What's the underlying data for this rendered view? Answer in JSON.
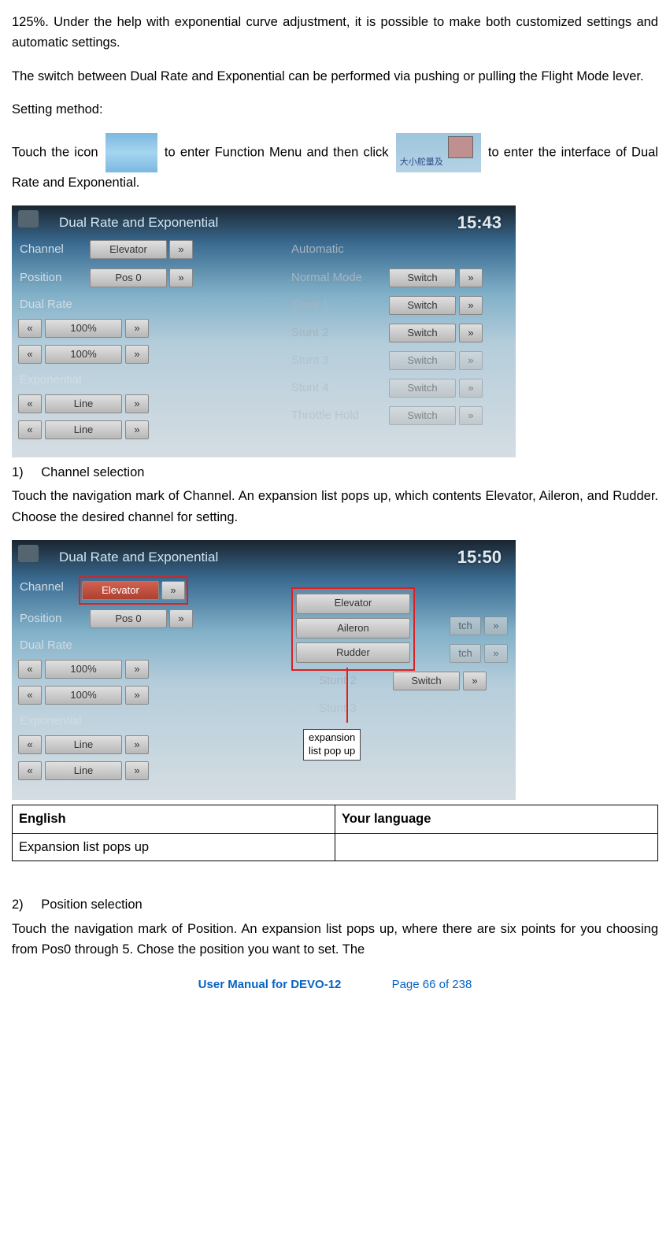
{
  "para1": "125%. Under the help with exponential curve adjustment, it is possible to make both customized settings and automatic settings.",
  "para2": "The switch between Dual Rate and Exponential can be performed via pushing or pulling the Flight Mode lever.",
  "para3": "Setting method:",
  "touch_pre": "Touch the icon ",
  "touch_mid": " to enter Function Menu and then click ",
  "touch_post": " to enter the interface of Dual Rate and Exponential.",
  "ss1": {
    "title": "Dual Rate and Exponential",
    "time": "15:43",
    "channel_lbl": "Channel",
    "channel_val": "Elevator",
    "position_lbl": "Position",
    "position_val": "Pos 0",
    "dualrate_lbl": "Dual Rate",
    "dr1": "100%",
    "dr2": "100%",
    "exp_lbl": "Exponential",
    "exp1": "Line",
    "exp2": "Line",
    "auto": "Automatic",
    "modes": [
      "Normal Mode",
      "Stunt 1",
      "Stunt 2",
      "Stunt 3",
      "Stunt 4",
      "Throttle Hold"
    ],
    "switch": "Switch"
  },
  "heading1_num": "1)",
  "heading1_txt": "Channel selection",
  "para_h1": "Touch the navigation mark of Channel. An expansion list pops up, which contents Elevator, Aileron, and Rudder. Choose the desired channel for setting.",
  "ss2": {
    "title": "Dual Rate and Exponential",
    "time": "15:50",
    "popup": [
      "Elevator",
      "Aileron",
      "Rudder"
    ],
    "callout": "expansion\nlist pop  up"
  },
  "table": {
    "h1": "English",
    "h2": "Your language",
    "r1": "Expansion list pops up"
  },
  "heading2_num": "2)",
  "heading2_txt": "Position selection",
  "para_h2": "Touch the navigation mark of Position. An expansion list pops up, where there are six points for you choosing from Pos0 through 5. Chose the position you want to set. The",
  "footer_left": "User Manual for DEVO-12",
  "footer_right": "Page 66 of 238"
}
